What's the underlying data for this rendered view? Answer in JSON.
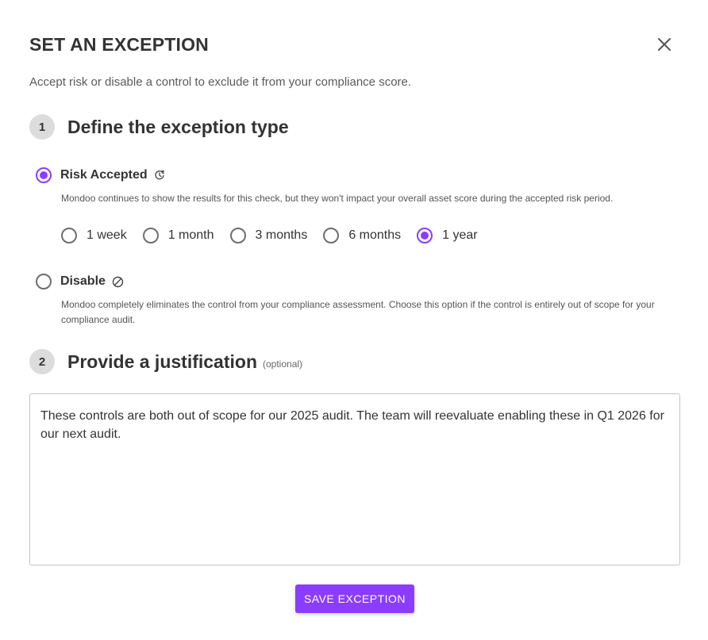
{
  "dialog": {
    "title": "SET AN EXCEPTION",
    "subtitle": "Accept risk or disable a control to exclude it from your compliance score.",
    "close_icon": "close-icon"
  },
  "step1": {
    "number": "1",
    "title": "Define the exception type"
  },
  "options": {
    "risk_accepted": {
      "label": "Risk Accepted",
      "icon": "snooze-clock-icon",
      "selected": true,
      "description": "Mondoo continues to show the results for this check, but they won't impact your overall asset score during the accepted risk period."
    },
    "disable": {
      "label": "Disable",
      "icon": "disabled-circle-icon",
      "selected": false,
      "description": "Mondoo completely eliminates the control from your compliance assessment. Choose this option if the control is entirely out of scope for your compliance audit."
    }
  },
  "durations": [
    {
      "label": "1 week",
      "selected": false
    },
    {
      "label": "1 month",
      "selected": false
    },
    {
      "label": "3 months",
      "selected": false
    },
    {
      "label": "6 months",
      "selected": false
    },
    {
      "label": "1 year",
      "selected": true
    }
  ],
  "step2": {
    "number": "2",
    "title": "Provide a justification",
    "optional_label": "(optional)"
  },
  "justification": {
    "value": "These controls are both out of scope for our 2025 audit. The team will reevaluate enabling these in Q1 2026 for our next audit."
  },
  "actions": {
    "save_label": "SAVE EXCEPTION"
  },
  "colors": {
    "accent": "#8b3dff",
    "text": "#333333",
    "step_badge": "#dcdcdc"
  }
}
